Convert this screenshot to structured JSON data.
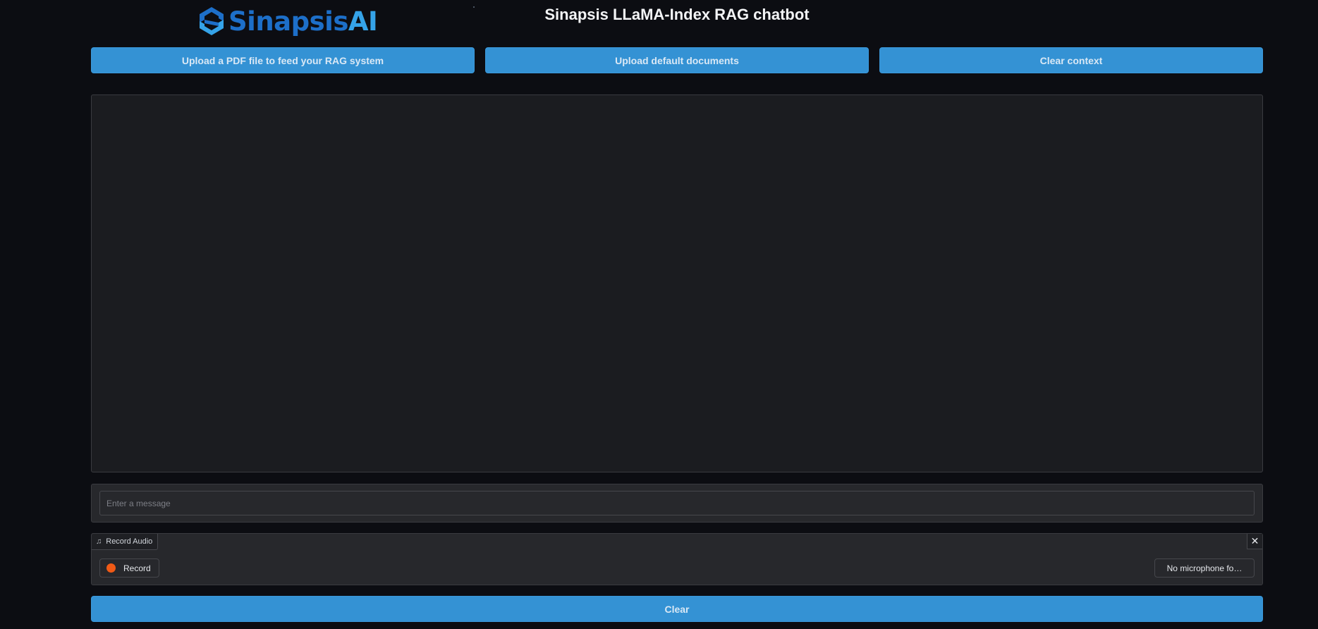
{
  "header": {
    "logo_part1": "Sinapsis",
    "logo_part2": "AI",
    "title": "Sinapsis LLaMA-Index RAG chatbot"
  },
  "toolbar": {
    "upload_pdf_label": "Upload a PDF file to feed your RAG system",
    "upload_default_label": "Upload default documents",
    "clear_context_label": "Clear context"
  },
  "chat": {
    "messages": []
  },
  "message_input": {
    "value": "",
    "placeholder": "Enter a message"
  },
  "audio": {
    "label": "Record Audio",
    "label_icon": "music-note-icon",
    "close_icon": "close-icon",
    "record_label": "Record",
    "microphone_select": "No microphone fo…"
  },
  "footer": {
    "clear_label": "Clear"
  },
  "colors": {
    "accent": "#3492d4",
    "record": "#f05a16",
    "logo_dark": "#1d6fc9",
    "logo_light": "#35a3e8"
  }
}
